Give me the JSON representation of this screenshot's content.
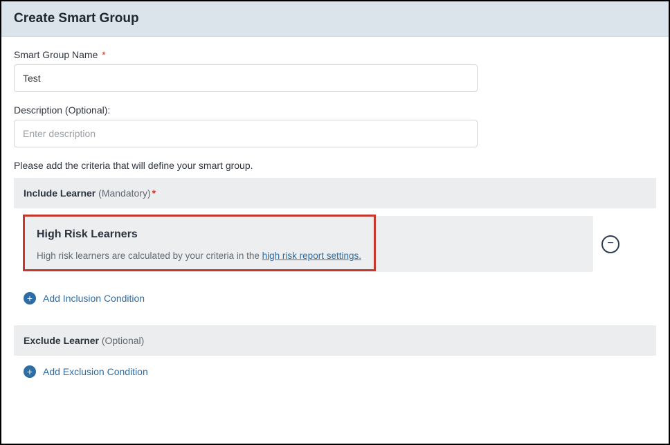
{
  "header": {
    "title": "Create Smart Group"
  },
  "name_field": {
    "label": "Smart Group Name",
    "required_mark": "*",
    "value": "Test"
  },
  "description_field": {
    "label": "Description (Optional):",
    "placeholder": "Enter description",
    "value": ""
  },
  "instructions": "Please add the criteria that will define your smart group.",
  "include_section": {
    "label_main": "Include Learner",
    "label_note": " (Mandatory)",
    "required_mark": "*",
    "condition": {
      "title": "High Risk Learners",
      "desc_prefix": "High risk learners are calculated by your criteria in the ",
      "desc_link": "high risk report settings."
    },
    "add_label": "Add Inclusion Condition"
  },
  "exclude_section": {
    "label_main": "Exclude Learner",
    "label_note": " (Optional)",
    "add_label": "Add Exclusion Condition"
  }
}
